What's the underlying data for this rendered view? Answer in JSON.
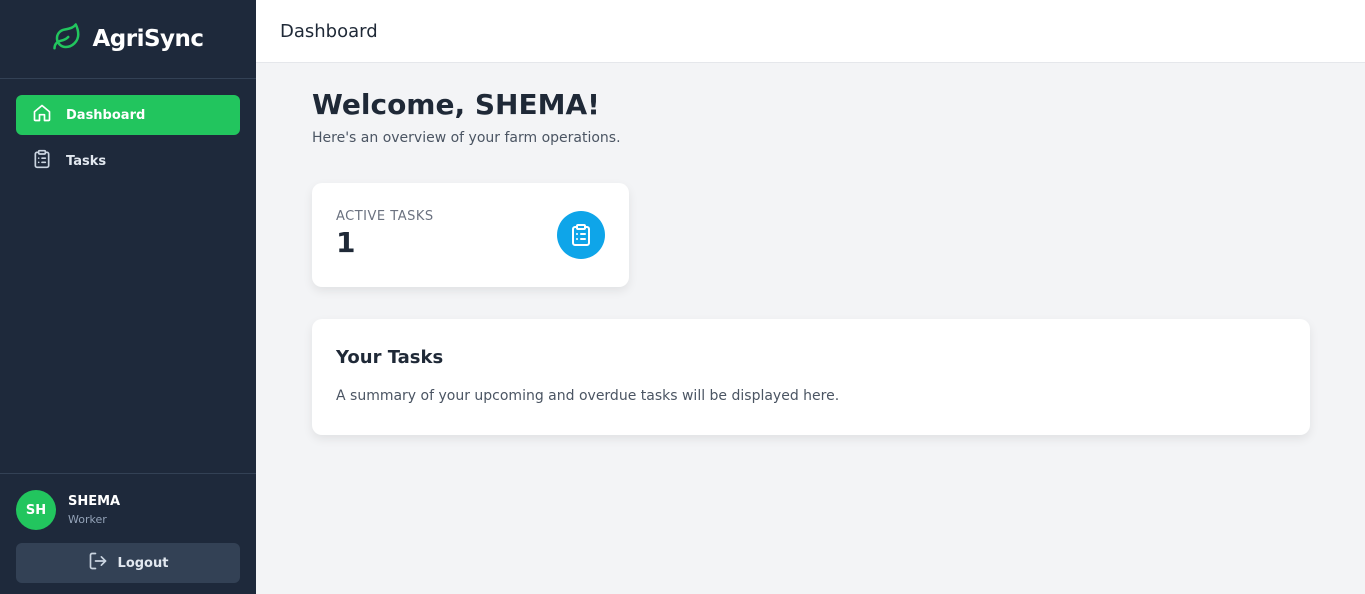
{
  "brand": {
    "name": "AgriSync",
    "icon": "leaf-icon",
    "accent": "#22c55e"
  },
  "sidebar": {
    "items": [
      {
        "label": "Dashboard",
        "icon": "home-icon",
        "active": true
      },
      {
        "label": "Tasks",
        "icon": "clipboard-list-icon",
        "active": false
      }
    ],
    "background": "#1e293b"
  },
  "user": {
    "initials": "SH",
    "name": "SHEMA",
    "role": "Worker"
  },
  "logout": {
    "label": "Logout",
    "icon": "logout-icon"
  },
  "header": {
    "title": "Dashboard"
  },
  "main": {
    "welcome": "Welcome, SHEMA!",
    "subtitle": "Here's an overview of your farm operations.",
    "stat": {
      "label": "ACTIVE TASKS",
      "value": "1",
      "icon": "clipboard-list-icon",
      "icon_color": "#0ea5e9"
    },
    "tasks_card": {
      "title": "Your Tasks",
      "description": "A summary of your upcoming and overdue tasks will be displayed here."
    }
  }
}
